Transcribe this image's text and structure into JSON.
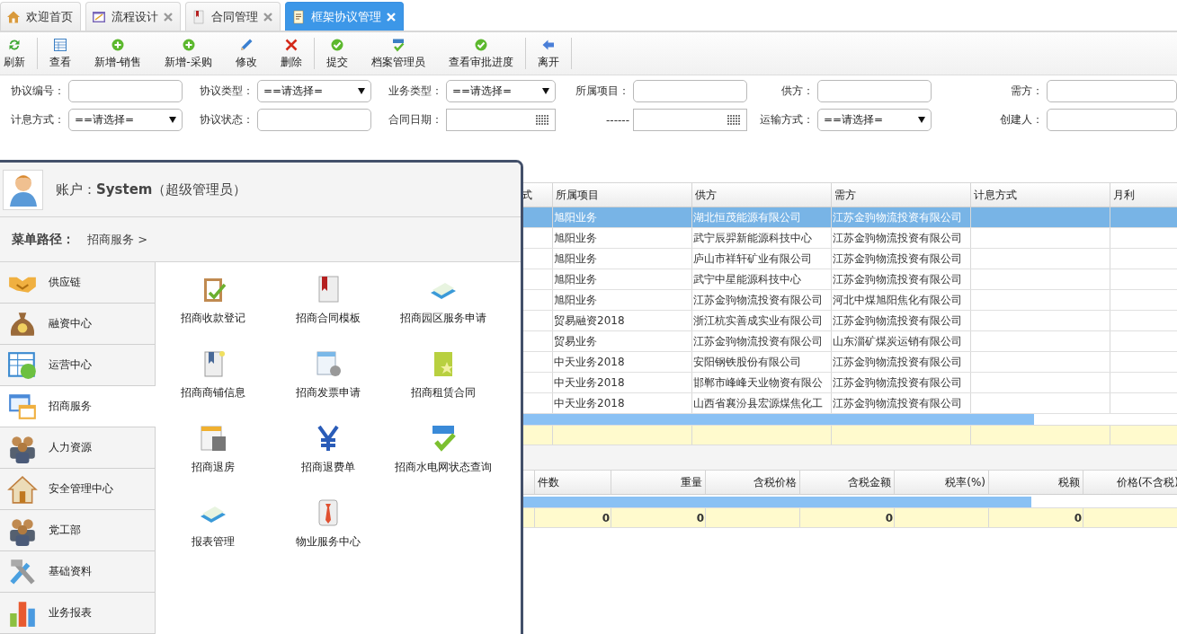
{
  "tabs": [
    {
      "label": "欢迎首页",
      "closable": false,
      "selected": false
    },
    {
      "label": "流程设计",
      "closable": true,
      "selected": false
    },
    {
      "label": "合同管理",
      "closable": true,
      "selected": false
    },
    {
      "label": "框架协议管理",
      "closable": true,
      "selected": true
    }
  ],
  "toolbar": {
    "groups": [
      [
        "刷新"
      ],
      [
        "查看",
        "新增-销售",
        "新增-采购",
        "修改",
        "删除"
      ],
      [
        "提交",
        "档案管理员",
        "查看审批进度"
      ],
      [
        "离开"
      ]
    ]
  },
  "filters": [
    [
      {
        "label": "协议编号：",
        "kind": "text"
      },
      {
        "label": "协议类型：",
        "kind": "select",
        "value": "==请选择="
      },
      {
        "label": "业务类型：",
        "kind": "select",
        "value": "==请选择="
      },
      {
        "label": "所属项目：",
        "kind": "text"
      },
      {
        "label": "供方：",
        "kind": "text"
      },
      {
        "label": "需方：",
        "kind": "text"
      }
    ],
    [
      {
        "label": "计息方式：",
        "kind": "select",
        "value": "==请选择="
      },
      {
        "label": "协议状态：",
        "kind": "text"
      },
      {
        "label": "合同日期：",
        "kind": "date"
      },
      {
        "label": "------",
        "kind": "date"
      },
      {
        "label": "运输方式：",
        "kind": "select",
        "value": "==请选择="
      },
      {
        "label": "创建人：",
        "kind": "text"
      }
    ]
  ],
  "table": {
    "columns": [
      "式",
      "所属项目",
      "供方",
      "需方",
      "计息方式",
      "月利"
    ],
    "rows": [
      {
        "selected": true,
        "project": "旭阳业务",
        "supplier": "湖北恒茂能源有限公司",
        "buyer": "江苏金驹物流投资有限公司"
      },
      {
        "selected": false,
        "project": "旭阳业务",
        "supplier": "武宁辰羿新能源科技中心",
        "buyer": "江苏金驹物流投资有限公司"
      },
      {
        "selected": false,
        "project": "旭阳业务",
        "supplier": "庐山市祥轩矿业有限公司",
        "buyer": "江苏金驹物流投资有限公司"
      },
      {
        "selected": false,
        "project": "旭阳业务",
        "supplier": "武宁中星能源科技中心",
        "buyer": "江苏金驹物流投资有限公司"
      },
      {
        "selected": false,
        "project": "旭阳业务",
        "supplier": "江苏金驹物流投资有限公司",
        "buyer": "河北中煤旭阳焦化有限公司"
      },
      {
        "selected": false,
        "project": "贸易融资2018",
        "supplier": "浙江杭实善成实业有限公司",
        "buyer": "江苏金驹物流投资有限公司"
      },
      {
        "selected": false,
        "project": "贸易业务",
        "supplier": "江苏金驹物流投资有限公司",
        "buyer": "山东淄矿煤炭运销有限公司"
      },
      {
        "selected": false,
        "project": "中天业务2018",
        "supplier": "安阳钢铁股份有限公司",
        "buyer": "江苏金驹物流投资有限公司"
      },
      {
        "selected": false,
        "project": "中天业务2018",
        "supplier": "邯郸市峰峰天业物资有限公",
        "buyer": "江苏金驹物流投资有限公司"
      },
      {
        "selected": false,
        "project": "中天业务2018",
        "supplier": "山西省襄汾县宏源煤焦化工",
        "buyer": "江苏金驹物流投资有限公司"
      }
    ]
  },
  "detail_table": {
    "columns": [
      {
        "label": "件数",
        "total": "0"
      },
      {
        "label": "重量",
        "total": "0"
      },
      {
        "label": "含税价格"
      },
      {
        "label": "含税金额",
        "total": "0"
      },
      {
        "label": "税率(%)"
      },
      {
        "label": "税额",
        "total": "0"
      },
      {
        "label": "价格(不含税)"
      }
    ]
  },
  "menu_popup": {
    "account": "账户：**System**（超级管理员）",
    "path_label": "菜单路径：",
    "path": "招商服务 >",
    "categories": [
      {
        "label": "供应链",
        "selected": false
      },
      {
        "label": "融资中心",
        "selected": false
      },
      {
        "label": "运营中心",
        "selected": false
      },
      {
        "label": "招商服务",
        "selected": true
      },
      {
        "label": "人力资源",
        "selected": false
      },
      {
        "label": "安全管理中心",
        "selected": false
      },
      {
        "label": "党工部",
        "selected": false
      },
      {
        "label": "基础资料",
        "selected": false
      },
      {
        "label": "业务报表",
        "selected": false
      }
    ],
    "items": [
      "招商收款登记",
      "招商合同模板",
      "招商园区服务申请",
      "招商商铺信息",
      "招商发票申请",
      "招商租赁合同",
      "招商退房",
      "招商退费单",
      "招商水电网状态查询",
      "报表管理",
      "物业服务中心"
    ]
  }
}
